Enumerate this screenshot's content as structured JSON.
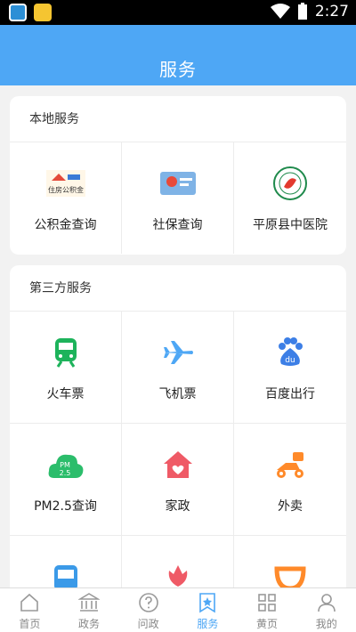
{
  "status": {
    "time": "2:27"
  },
  "header": {
    "title": "服务"
  },
  "local": {
    "title": "本地服务",
    "items": [
      {
        "label": "公积金查询",
        "icon": "housing-fund-icon",
        "logo_text": "住房公积金"
      },
      {
        "label": "社保查询",
        "icon": "social-security-card-icon"
      },
      {
        "label": "平原县中医院",
        "icon": "hospital-logo-icon"
      }
    ]
  },
  "third": {
    "title": "第三方服务",
    "items": [
      {
        "label": "火车票",
        "icon": "train-icon"
      },
      {
        "label": "飞机票",
        "icon": "airplane-icon"
      },
      {
        "label": "百度出行",
        "icon": "baidu-paw-icon",
        "glyph": "du"
      },
      {
        "label": "PM2.5查询",
        "icon": "pm25-cloud-icon",
        "glyph_top": "PM",
        "glyph_bottom": "2.5"
      },
      {
        "label": "家政",
        "icon": "house-heart-icon"
      },
      {
        "label": "外卖",
        "icon": "scooter-icon"
      },
      {
        "label": "",
        "icon": "bus-icon"
      },
      {
        "label": "",
        "icon": "flower-icon"
      },
      {
        "label": "",
        "icon": "didi-icon"
      }
    ]
  },
  "tabs": [
    {
      "label": "首页",
      "icon": "home-icon"
    },
    {
      "label": "政务",
      "icon": "government-building-icon"
    },
    {
      "label": "问政",
      "icon": "question-icon"
    },
    {
      "label": "服务",
      "icon": "service-star-icon",
      "active": true
    },
    {
      "label": "黄页",
      "icon": "grid-icon"
    },
    {
      "label": "我的",
      "icon": "user-icon"
    }
  ],
  "colors": {
    "header": "#4ea7f5",
    "train": "#1db35b",
    "plane": "#4ea7f5",
    "baidu": "#3d7fe6",
    "pm": "#2bbd6b",
    "house": "#ef5a66",
    "scooter": "#ff8a2a",
    "bus": "#3b9ae8",
    "flower": "#ef5a66",
    "didi": "#ff8a2a"
  }
}
